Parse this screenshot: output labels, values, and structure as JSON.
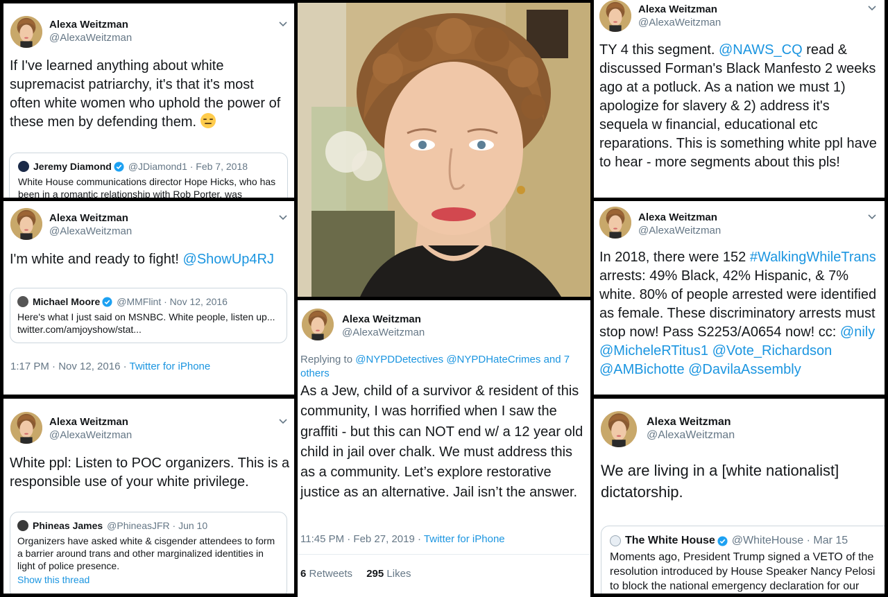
{
  "profile": {
    "name": "Alexa Weitzman",
    "handle": "@AlexaWeitzman"
  },
  "tweet1": {
    "text": "If I've learned anything about white supremacist patriarchy, it's that it's most often white women who uphold the power of these men by defending them.",
    "emoji_icon": "unamused-face-emoji",
    "quote": {
      "name": "Jeremy Diamond",
      "handle_date": "@JDiamond1 · Feb 7, 2018",
      "text": "White House communications director Hope Hicks, who has been in a romantic relationship with Rob Porter, was"
    }
  },
  "tweet2": {
    "text_prefix": "I'm white and ready to fight!",
    "mention": "@ShowUp4RJ",
    "quote": {
      "name": "Michael Moore",
      "handle_date": "@MMFlint · Nov 12, 2016",
      "text": "Here's what I just said on MSNBC. White people, listen up... twitter.com/amjoyshow/stat..."
    },
    "time": "1:17 PM · Nov 12, 2016 ·",
    "source": "Twitter for iPhone"
  },
  "tweet3": {
    "text": "White ppl: Listen to POC organizers. This is a responsible use of your white privilege.",
    "quote": {
      "name": "Phineas James",
      "handle_date": "@PhineasJFR · Jun 10",
      "text": "Organizers have asked white & cisgender attendees to form a barrier around trans and other marginalized identities in light of police presence.",
      "show_thread": "Show this thread"
    }
  },
  "tweet4": {
    "reply_prefix": "Replying to",
    "reply_targets": "@NYPDDetectives @NYPDHateCrimes and 7 others",
    "text": "As a Jew, child of a survivor & resident of this community, I was horrified when I saw the graffiti - but this can NOT end w/ a 12 year old child in jail over chalk. We must address this as a community. Let’s explore restorative justice as an alternative. Jail isn’t the answer.",
    "time": "11:45 PM · Feb 27, 2019 ·",
    "source": "Twitter for iPhone",
    "retweets_count": "6",
    "retweets_label": "Retweets",
    "likes_count": "295",
    "likes_label": "Likes"
  },
  "tweet5": {
    "text_a": "TY 4 this segment.",
    "mention": "@NAWS_CQ",
    "text_b": "read & discussed Forman's Black Manfesto 2 weeks ago at a potluck. As a nation we must 1) apologize for slavery & 2) address it's sequela w financial, educational etc reparations. This is something white ppl have to hear - more segments about this pls!"
  },
  "tweet6": {
    "text_a": "In 2018, there were 152",
    "hashtag": "#WalkingWhileTrans",
    "text_b": "arrests: 49% Black, 42% Hispanic, & 7% white. 80% of people arrested were identified as female. These discriminatory arrests must stop now! Pass S2253/A0654 now! cc:",
    "mentions": "@nily @MicheleRTitus1 @Vote_Richardson @AMBichotte @DavilaAssembly"
  },
  "tweet7": {
    "text": "We are living in a [white nationalist] dictatorship.",
    "quote": {
      "name": "The White House",
      "handle_date": "@WhiteHouse · Mar 15",
      "text": "Moments ago, President Trump signed a VETO of the resolution introduced by House Speaker Nancy Pelosi to block the national emergency declaration for our crisis"
    }
  },
  "colors": {
    "link": "#1b95e0",
    "secondary_text": "#657786",
    "border": "#ccd6dd",
    "background": "#000000"
  }
}
